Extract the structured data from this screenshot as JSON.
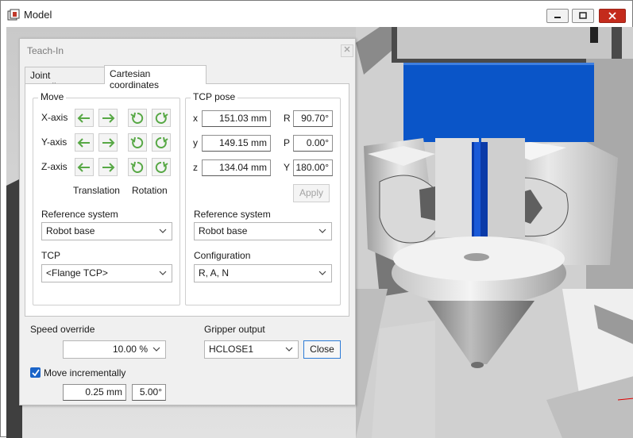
{
  "window": {
    "title": "Model"
  },
  "panel": {
    "title": "Teach-In",
    "tabs": [
      {
        "label": "Joint coordinates",
        "active": false
      },
      {
        "label": "Cartesian coordinates",
        "active": true
      }
    ],
    "move": {
      "label": "Move",
      "axes": [
        "X-axis",
        "Y-axis",
        "Z-axis"
      ],
      "translation_label": "Translation",
      "rotation_label": "Rotation",
      "icon_color": "#57a845"
    },
    "left_ref": {
      "label": "Reference system",
      "value": "Robot base"
    },
    "tcp": {
      "label": "TCP",
      "value": "<Flange TCP>"
    },
    "tcp_pose": {
      "label": "TCP pose",
      "x_label": "x",
      "x_value": "151.03 mm",
      "y_label": "y",
      "y_value": "149.15 mm",
      "z_label": "z",
      "z_value": "134.04 mm",
      "r_label": "R",
      "r_value": "90.70°",
      "p_label": "P",
      "p_value": "0.00°",
      "yaw_label": "Y",
      "yaw_value": "180.00°",
      "apply_label": "Apply"
    },
    "right_ref": {
      "label": "Reference system",
      "value": "Robot base"
    },
    "configuration": {
      "label": "Configuration",
      "value": "R, A, N"
    },
    "speed": {
      "label": "Speed override",
      "value": "10.00 %"
    },
    "gripper": {
      "label": "Gripper output",
      "value": "HCLOSE1",
      "close_label": "Close"
    },
    "incremental": {
      "label": "Move incrementally",
      "checked": true,
      "step_translation": "0.25 mm",
      "step_rotation": "5.00°"
    }
  },
  "colors": {
    "accent": "#1a64c8",
    "close_button": "#c42b1c",
    "gripper_blue": "#0a55c8"
  }
}
